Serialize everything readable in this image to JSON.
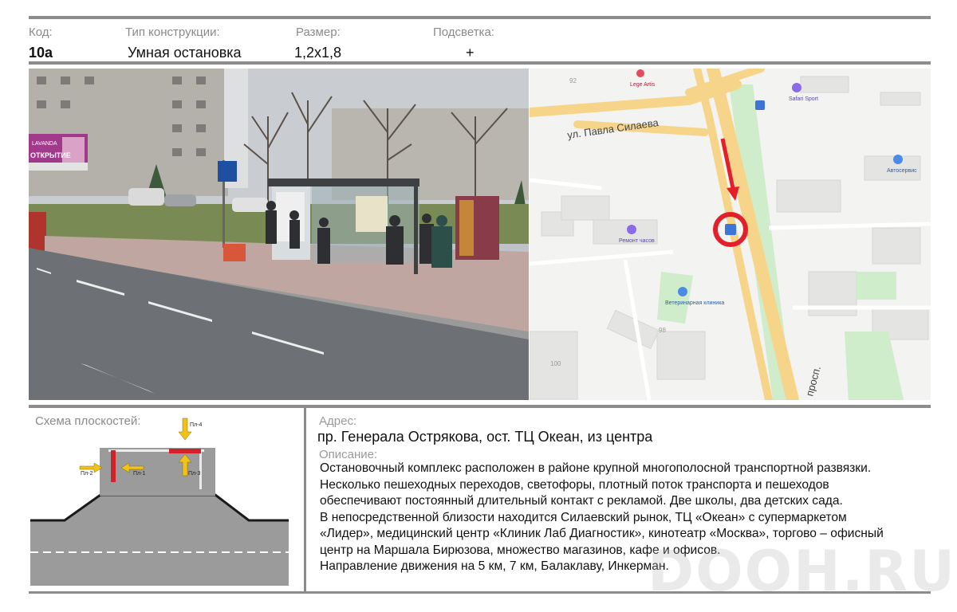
{
  "header": {
    "code_label": "Код:",
    "code_value": "10а",
    "type_label": "Тип конструкции:",
    "type_value": "Умная остановка",
    "size_label": "Размер:",
    "size_value": "1,2х1,8",
    "light_label": "Подсветка:",
    "light_value": "+"
  },
  "photo": {
    "billboard_brand": "LAVANDA",
    "billboard_text": "ОТКРЫТИЕ"
  },
  "map": {
    "street_label": "ул. Павла Силаева",
    "avenue_label": "просп.",
    "poi": [
      "Lege Artis",
      "Safari Sport",
      "Автосервис",
      "Ремонт часов",
      "Ветеринарная клиника"
    ],
    "house_numbers": [
      "92",
      "98",
      "100"
    ],
    "colors": {
      "road": "#f6d58a",
      "green": "#cfeccb",
      "marker": "#e3202a",
      "poi": "#8a6de6"
    }
  },
  "scheme": {
    "title": "Схема плоскостей:",
    "planes": [
      "Пл-1",
      "Пл-2",
      "Пл-3",
      "Пл-4"
    ]
  },
  "address": {
    "label": "Адрес:",
    "value": "пр. Генерала Острякова, ост. ТЦ Океан, из центра"
  },
  "description": {
    "label": "Описание:",
    "lines": [
      "Остановочный комплекс расположен в районе крупной  многополосной транспортной развязки.",
      "Несколько пешеходных переходов, светофоры, плотный поток транспорта и пешеходов",
      "обеспечивают постоянный длительный контакт с рекламой. Две школы, два детских сада.",
      "В непосредственной близости находится Силаевский рынок, ТЦ «Океан» с супермаркетом",
      "«Лидер», медицинский центр «Клиник Лаб Диагностик», кинотеатр «Москва», торгово – офисный",
      "центр на Маршала Бирюзова, множество магазинов, кафе и офисов.",
      "Направление движения на 5 км, 7 км, Балаклаву, Инкерман."
    ]
  },
  "watermark": "DOOH.RU"
}
